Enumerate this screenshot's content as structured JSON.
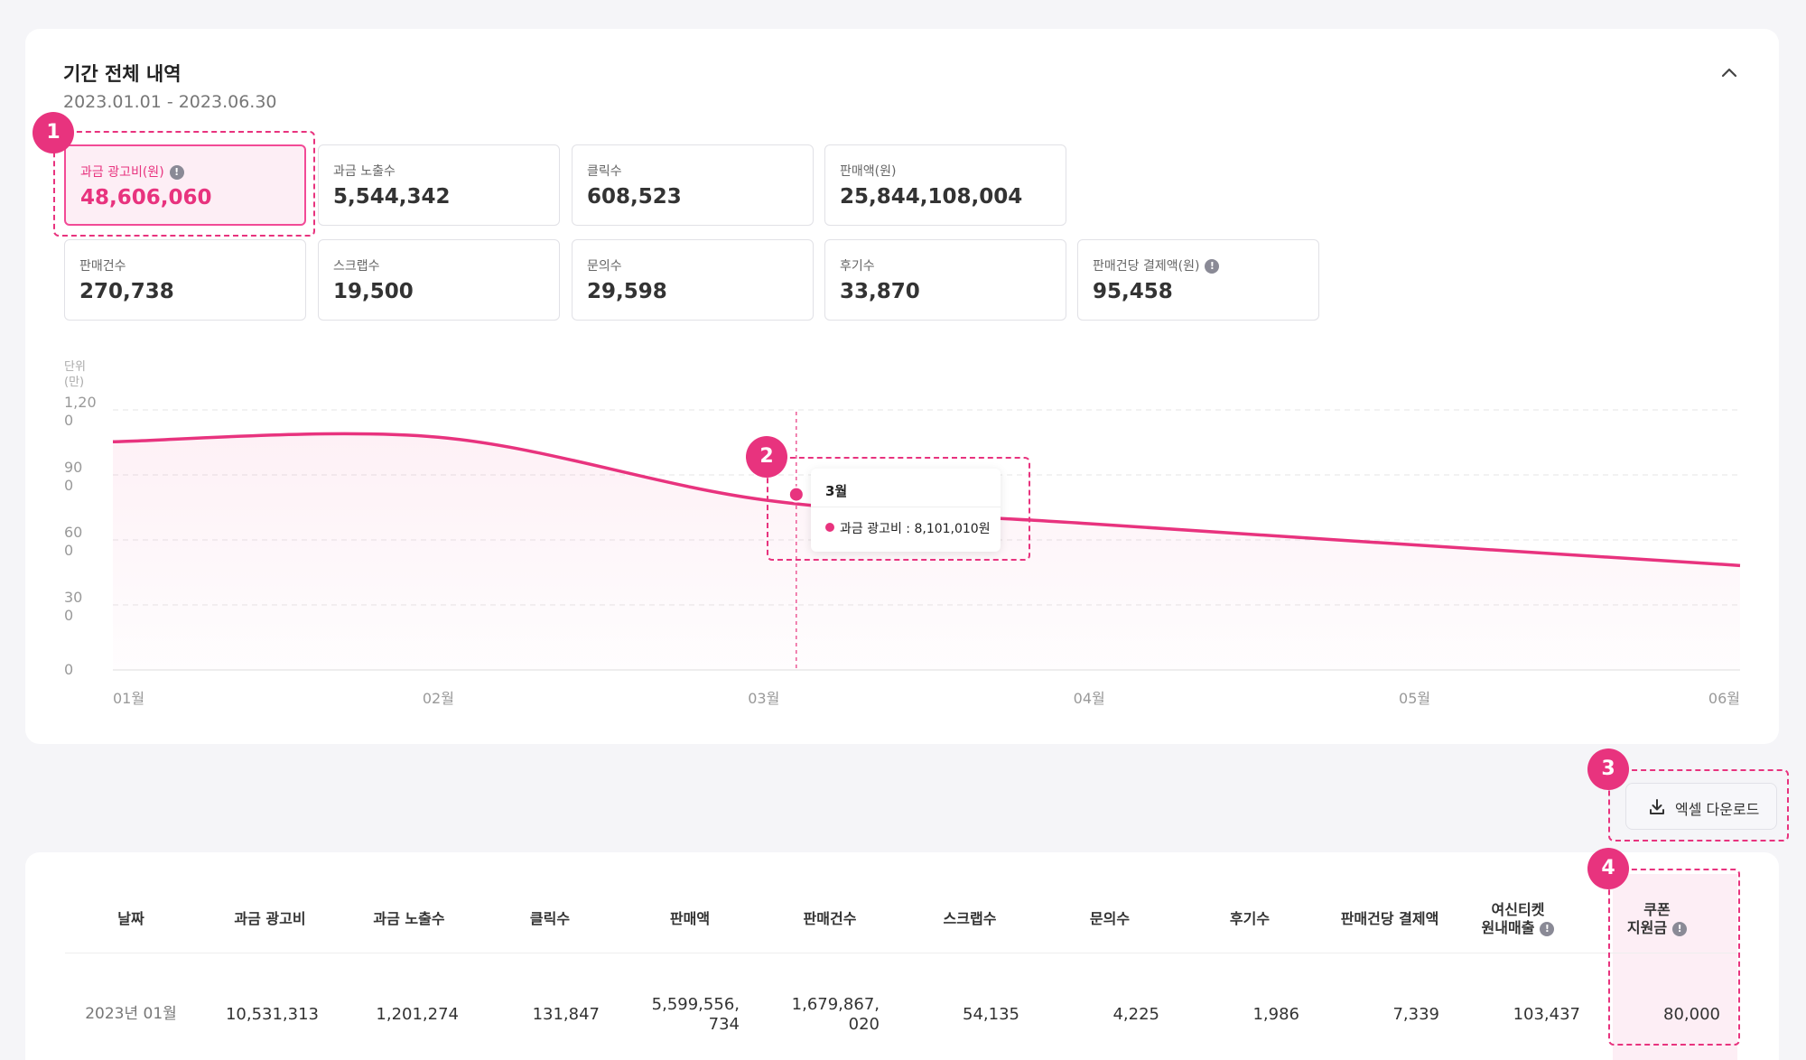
{
  "summary": {
    "title": "기간 전체 내역",
    "range": "2023.01.01 - 2023.06.30"
  },
  "metrics": [
    {
      "label": "과금 광고비(원)",
      "value": "48,606,060",
      "info": true,
      "active": true
    },
    {
      "label": "과금 노출수",
      "value": "5,544,342"
    },
    {
      "label": "클릭수",
      "value": "608,523"
    },
    {
      "label": "판매액(원)",
      "value": "25,844,108,004"
    },
    {
      "label": "판매건수",
      "value": "270,738"
    },
    {
      "label": "스크랩수",
      "value": "19,500"
    },
    {
      "label": "문의수",
      "value": "29,598"
    },
    {
      "label": "후기수",
      "value": "33,870"
    },
    {
      "label": "판매건당 결제액(원)",
      "value": "95,458",
      "info": true
    }
  ],
  "chart_data": {
    "type": "area",
    "unit_label": [
      "단위",
      "(만)"
    ],
    "y_ticks": [
      [
        "1,20",
        "0"
      ],
      [
        "90",
        "0"
      ],
      [
        "60",
        "0"
      ],
      [
        "30",
        "0"
      ],
      [
        "0"
      ]
    ],
    "ylim": [
      0,
      1200
    ],
    "categories": [
      "01월",
      "02월",
      "03월",
      "04월",
      "05월",
      "06월"
    ],
    "series": [
      {
        "name": "과금 광고비",
        "values": [
          1053,
          1074,
          785,
          675,
          577,
          482
        ]
      }
    ],
    "hover": {
      "x": 2.1,
      "y": 810
    },
    "color": "#e8337e",
    "grid": true
  },
  "tooltip": {
    "month": "3월",
    "text": "과금 광고비 : 8,101,010원"
  },
  "callouts": [
    "1",
    "2",
    "3",
    "4"
  ],
  "excel_button": "엑셀 다운로드",
  "table": {
    "headers": [
      "날짜",
      "과금 광고비",
      "과금 노출수",
      "클릭수",
      "판매액",
      "판매건수",
      "스크랩수",
      "문의수",
      "후기수",
      "판매건당 결제액",
      "여신티켓\n원내매출",
      "쿠폰\n지원금"
    ],
    "rows": [
      [
        "2023년 01월",
        "10,531,313",
        "1,201,274",
        "131,847",
        "5,599,556,\n734",
        "1,679,867,\n020",
        "54,135",
        "4,225",
        "1,986",
        "7,339",
        "103,437",
        "80,000"
      ]
    ]
  }
}
